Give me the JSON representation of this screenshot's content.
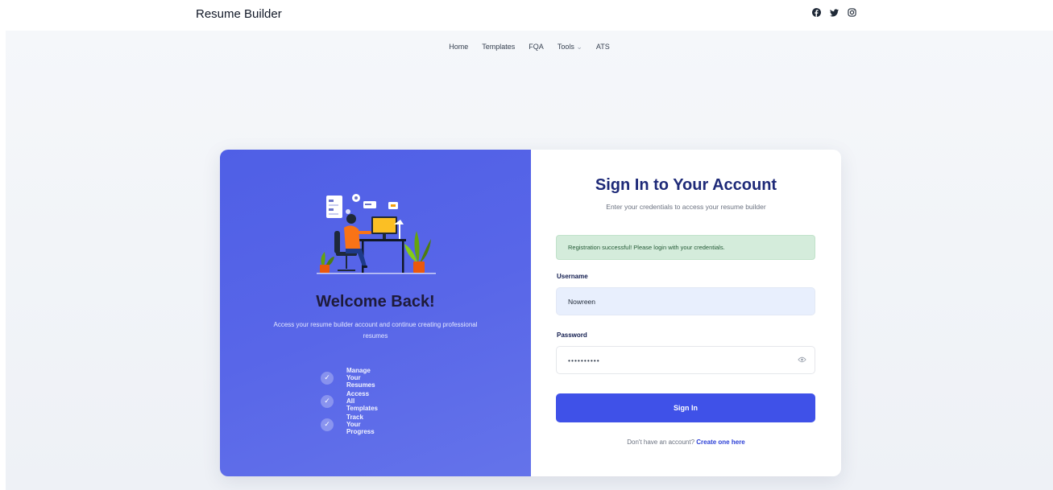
{
  "header": {
    "brand": "Resume Builder",
    "social_icons": [
      "facebook-icon",
      "twitter-icon",
      "instagram-icon"
    ]
  },
  "nav": {
    "items": [
      "Home",
      "Templates",
      "FQA",
      "Tools",
      "ATS"
    ],
    "tools_caret": "⌄"
  },
  "welcome_panel": {
    "heading": "Welcome Back!",
    "description": "Access your resume builder account and continue creating professional resumes",
    "features": [
      "Manage Your Resumes",
      "Access All Templates",
      "Track Your Progress"
    ],
    "accent_color": "#5866e8"
  },
  "login_form": {
    "title": "Sign In to Your Account",
    "subtitle": "Enter your credentials to access your resume builder",
    "alert": "Registration successful! Please login with your credentials.",
    "username_label": "Username",
    "username_value": "Nowreen",
    "password_label": "Password",
    "password_value": "••••••••••",
    "submit_label": "Sign In",
    "footer_text": "Don't have an account?",
    "footer_link": "Create one here",
    "button_color": "#3f51e8"
  }
}
